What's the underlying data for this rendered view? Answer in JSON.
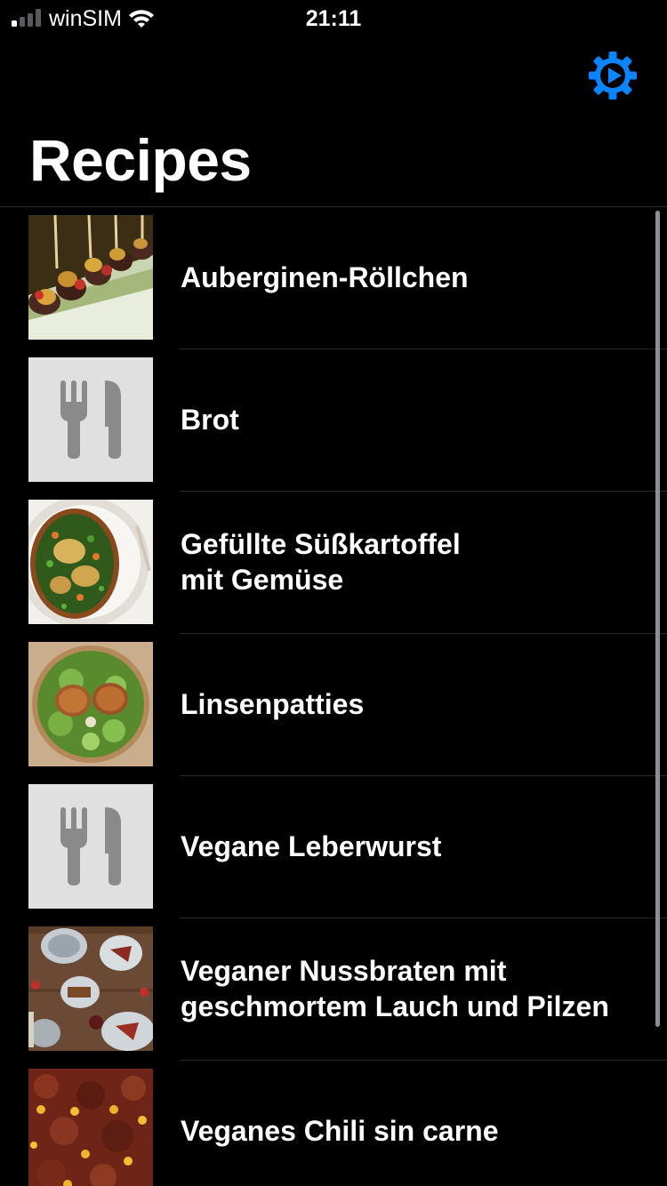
{
  "status_bar": {
    "carrier": "winSIM",
    "time": "21:11"
  },
  "nav": {
    "title": "Recipes",
    "settings_icon": "gear-icon",
    "accent_color": "#0a84ff"
  },
  "recipes": [
    {
      "title_lines": [
        "Auberginen-Röllchen"
      ],
      "thumbnail": "photo-eggplant-rolls"
    },
    {
      "title_lines": [
        "Brot"
      ],
      "thumbnail": "placeholder-fork-knife"
    },
    {
      "title_lines": [
        "Gefüllte Süßkartoffel",
        "mit Gemüse"
      ],
      "thumbnail": "photo-stuffed-sweet-potato"
    },
    {
      "title_lines": [
        "Linsenpatties"
      ],
      "thumbnail": "photo-lentil-patties-salad"
    },
    {
      "title_lines": [
        "Vegane Leberwurst"
      ],
      "thumbnail": "placeholder-fork-knife"
    },
    {
      "title_lines": [
        "Veganer Nussbraten mit",
        "geschmortem Lauch und Pilzen"
      ],
      "thumbnail": "photo-nut-roast-table"
    },
    {
      "title_lines": [
        "Veganes Chili sin carne"
      ],
      "thumbnail": "photo-chili"
    }
  ]
}
